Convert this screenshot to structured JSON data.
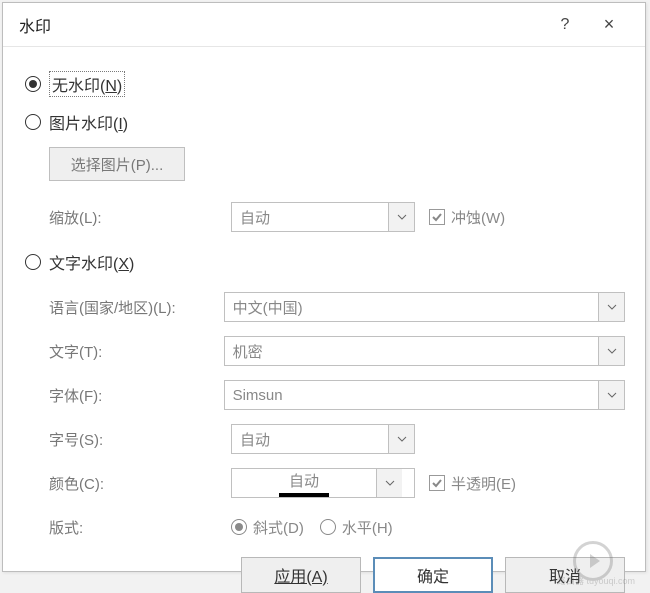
{
  "dialog": {
    "title": "水印",
    "help": "?",
    "close": "×"
  },
  "options": {
    "none": {
      "label": "无水印(",
      "accel": "N",
      "suffix": ")"
    },
    "picture": {
      "label": "图片水印(",
      "accel": "I",
      "suffix": ")"
    },
    "text": {
      "label": "文字水印(",
      "accel": "X",
      "suffix": ")"
    },
    "selected": "none"
  },
  "picture_section": {
    "select_button": "选择图片(P)...",
    "scale_label": "缩放(L):",
    "scale_value": "自动",
    "washout_label": "冲蚀(W)",
    "washout_checked": true
  },
  "text_section": {
    "language_label": "语言(国家/地区)(L):",
    "language_value": "中文(中国)",
    "text_label": "文字(T):",
    "text_value": "机密",
    "font_label": "字体(F):",
    "font_value": "Simsun",
    "size_label": "字号(S):",
    "size_value": "自动",
    "color_label": "颜色(C):",
    "color_value": "自动",
    "semi_label": "半透明(E)",
    "semi_checked": true,
    "layout_label": "版式:",
    "diagonal_label": "斜式(D)",
    "horizontal_label": "水平(H)",
    "layout_selected": "diagonal"
  },
  "buttons": {
    "apply": "应用(A)",
    "ok": "确定",
    "cancel": "取消"
  },
  "badge_text": "路由器 tuyouqi.com"
}
